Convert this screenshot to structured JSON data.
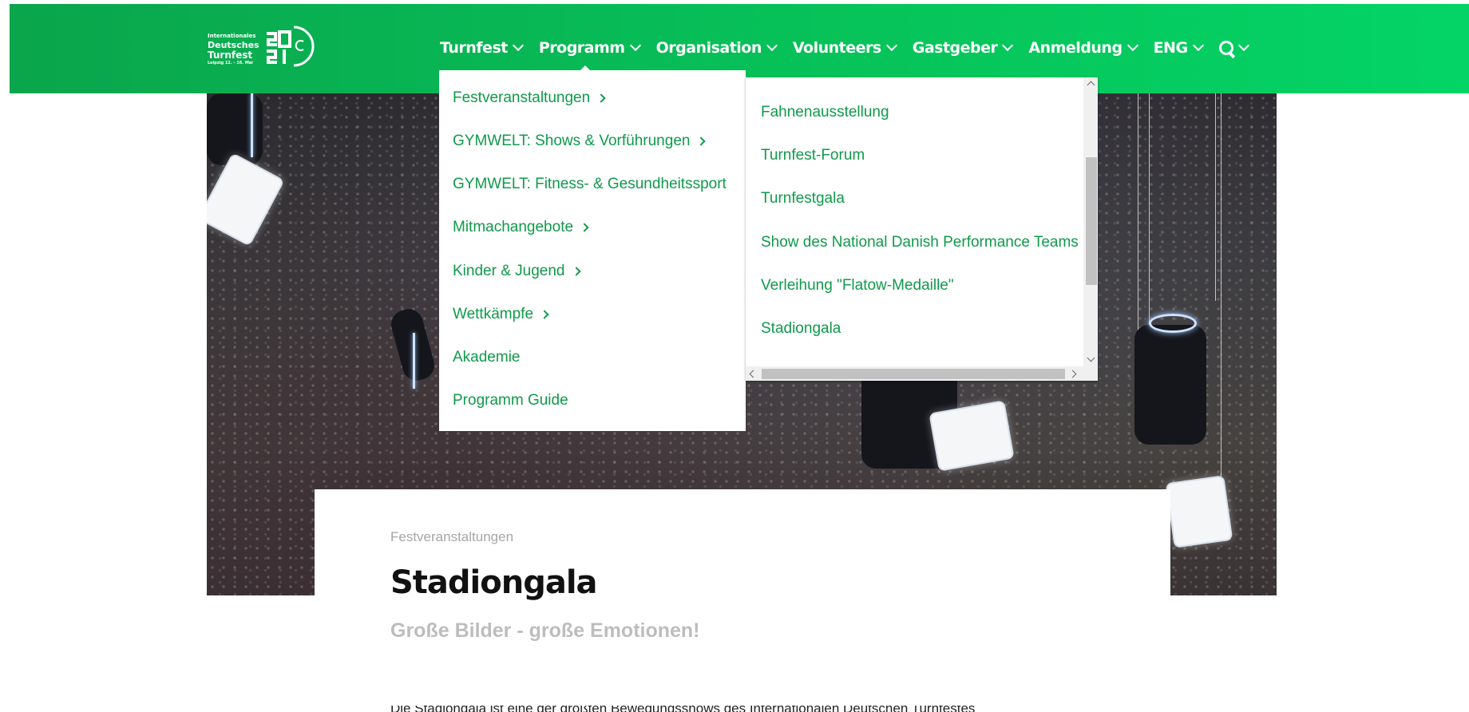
{
  "logo": {
    "line1": "Internationales",
    "line2": "Deutsches",
    "line3": "Turnfest",
    "line4": "Leipzig 12. - 16. Mai",
    "year": "2021"
  },
  "nav": {
    "items": [
      {
        "label": "Turnfest"
      },
      {
        "label": "Programm"
      },
      {
        "label": "Organisation"
      },
      {
        "label": "Volunteers"
      },
      {
        "label": "Gastgeber"
      },
      {
        "label": "Anmeldung"
      },
      {
        "label": "ENG"
      }
    ],
    "search_icon": "search-icon"
  },
  "menu": {
    "items": [
      {
        "label": "Festveranstaltungen",
        "has_sub": true
      },
      {
        "label": "GYMWELT: Shows & Vorführungen",
        "has_sub": true
      },
      {
        "label": "GYMWELT: Fitness- & Gesundheitssport",
        "has_sub": false
      },
      {
        "label": "Mitmachangebote",
        "has_sub": true
      },
      {
        "label": "Kinder & Jugend",
        "has_sub": true
      },
      {
        "label": "Wettkämpfe",
        "has_sub": true
      },
      {
        "label": "Akademie",
        "has_sub": false
      },
      {
        "label": "Programm Guide",
        "has_sub": false
      }
    ]
  },
  "submenu": {
    "items": [
      {
        "label": "Fahnenausstellung"
      },
      {
        "label": "Turnfest-Forum"
      },
      {
        "label": "Turnfestgala"
      },
      {
        "label": "Show des National Danish Performance Teams"
      },
      {
        "label": "Verleihung \"Flatow-Medaille\""
      },
      {
        "label": "Stadiongala"
      }
    ]
  },
  "content": {
    "breadcrumb": "Festveranstaltungen",
    "title": "Stadiongala",
    "subtitle": "Große Bilder - große Emotionen!",
    "body": "Die Stadiongala ist eine der größten Bewegungsshows des Internationalen Deutschen Turnfestes"
  },
  "colors": {
    "brand_green": "#06c45a",
    "link_green": "#0f9a4a"
  }
}
